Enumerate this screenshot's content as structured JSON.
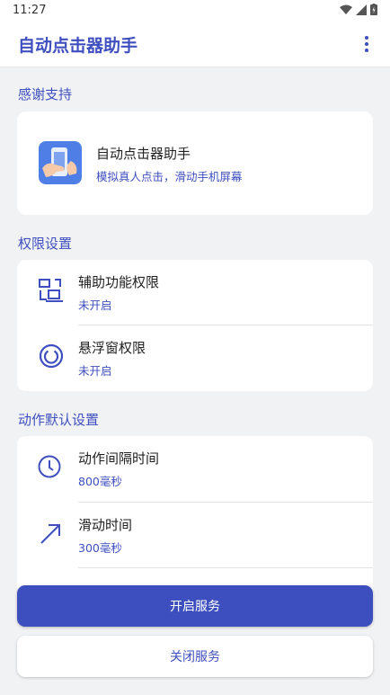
{
  "status": {
    "time": "11:27"
  },
  "appbar": {
    "title": "自动点击器助手"
  },
  "support": {
    "section_title": "感谢支持",
    "app_name": "自动点击器助手",
    "app_desc": "模拟真人点击，滑动手机屏幕"
  },
  "permissions": {
    "section_title": "权限设置",
    "items": [
      {
        "label": "辅助功能权限",
        "status": "未开启",
        "icon": "accessibility-icon"
      },
      {
        "label": "悬浮窗权限",
        "status": "未开启",
        "icon": "floating-window-icon"
      }
    ]
  },
  "defaults": {
    "section_title": "动作默认设置",
    "items": [
      {
        "label": "动作间隔时间",
        "value": "800毫秒",
        "icon": "clock-icon"
      },
      {
        "label": "滑动时间",
        "value": "300毫秒",
        "icon": "swipe-arrow-icon"
      }
    ]
  },
  "actions": {
    "start_label": "开启服务",
    "stop_label": "关闭服务"
  },
  "colors": {
    "accent": "#3f4fbf",
    "button": "#3d4fbf",
    "background": "#f1f2f4"
  }
}
